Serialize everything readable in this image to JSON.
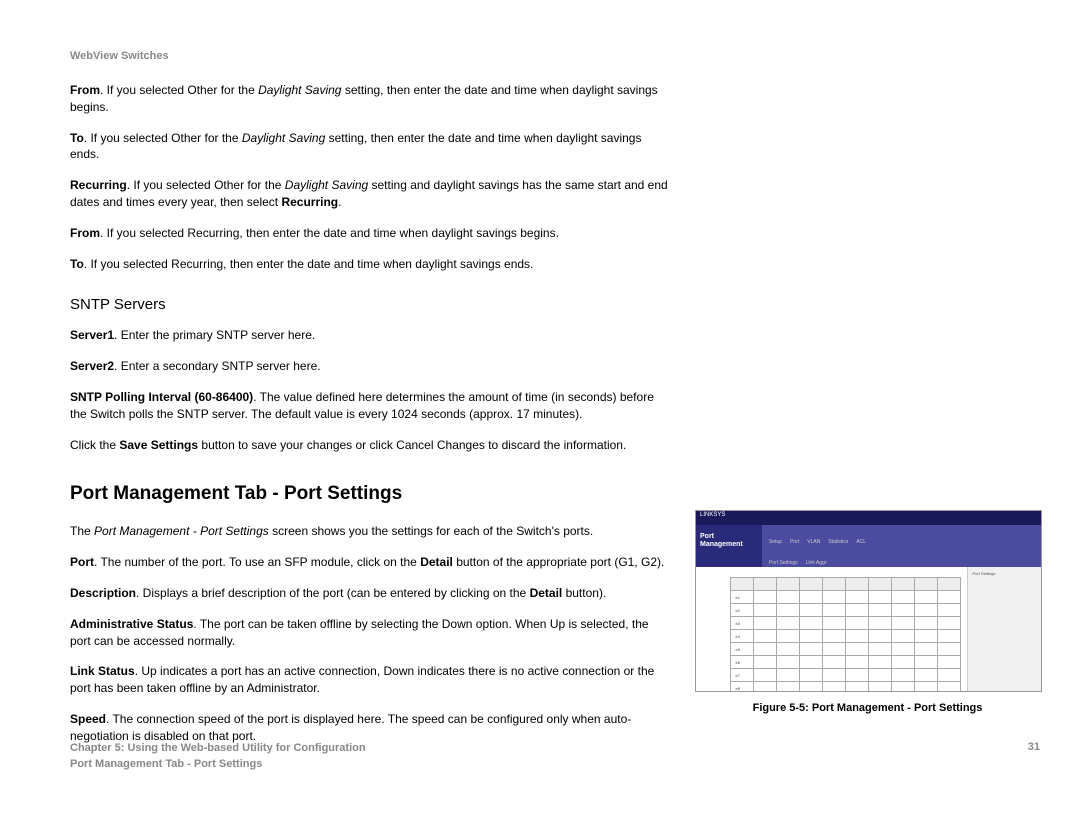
{
  "header": "WebView Switches",
  "paras": {
    "from1_b": "From",
    "from1_rest1": ". If you selected Other for the ",
    "from1_i": "Daylight Saving",
    "from1_rest2": " setting, then enter the date and time when daylight savings begins.",
    "to1_b": "To",
    "to1_rest1": ". If you selected Other for the ",
    "to1_i": "Daylight Saving",
    "to1_rest2": " setting, then enter the date and time when daylight savings ends.",
    "rec_b": "Recurring",
    "rec_rest1": ". If you selected Other for the ",
    "rec_i": "Daylight Saving",
    "rec_rest2": " setting and daylight savings has the same start and end dates and times every year, then select ",
    "rec_b2": "Recurring",
    "rec_rest3": ".",
    "from2_b": "From",
    "from2_rest": ". If you selected Recurring, then enter the date and time when daylight savings begins.",
    "to2_b": "To",
    "to2_rest": ". If you selected Recurring, then enter the date and time when daylight savings ends."
  },
  "sntp_heading": "SNTP Servers",
  "sntp": {
    "s1_b": "Server1",
    "s1_rest": ". Enter the primary SNTP server here.",
    "s2_b": "Server2",
    "s2_rest": ". Enter a secondary SNTP server here.",
    "poll_b": "SNTP Polling Interval (60-86400)",
    "poll_rest": ". The value defined here determines the amount of time (in seconds) before the Switch polls the SNTP server. The default value is every 1024 seconds (approx. 17 minutes).",
    "save1": "Click the ",
    "save_b": "Save Settings",
    "save2": " button to save your changes or click Cancel Changes to discard the information."
  },
  "main_heading": "Port Management Tab - Port Settings",
  "port": {
    "intro1": "The ",
    "intro_i": "Port Management - Port Settings",
    "intro2": " screen shows you the settings for each of the Switch's ports.",
    "port_b": "Port",
    "port_rest1": ". The number of the port. To use an SFP module, click on the ",
    "port_b2": "Detail",
    "port_rest2": " button of the appropriate port (G1, G2).",
    "desc_b": "Description",
    "desc_rest1": ". Displays a brief description of the port (can be entered by clicking on the ",
    "desc_b2": "Detail",
    "desc_rest2": " button).",
    "admin_b": "Administrative Status",
    "admin_rest": ". The port can be taken offline by selecting the Down option. When Up is selected, the port can be accessed normally.",
    "link_b": "Link Status",
    "link_rest": ". Up indicates a port has an active connection, Down indicates there is no active connection or the port has been taken offline by an Administrator.",
    "speed_b": "Speed",
    "speed_rest": ". The connection speed of the port is displayed here. The speed can be configured only when auto-negotiation is disabled on that port."
  },
  "figure": {
    "topbar": "LINKSYS",
    "sidebar": "Port Management",
    "caption": "Figure 5-5: Port Management - Port Settings",
    "rightbox_title": "Port Settings"
  },
  "footer": {
    "line1": "Chapter 5: Using the Web-based Utility for Configuration",
    "line2": "Port Management Tab - Port Settings",
    "page": "31"
  }
}
